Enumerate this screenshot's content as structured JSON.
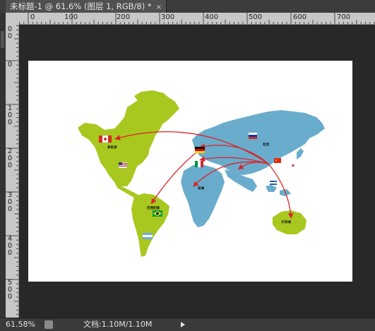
{
  "document_tab": {
    "title": "未标题-1 @ 61.6% (图层 1, RGB/8) *",
    "close": "×"
  },
  "ruler_top_labels": [
    "0",
    "100",
    "200",
    "300",
    "400",
    "500",
    "600",
    "700"
  ],
  "ruler_left_labels": [
    {
      "digits": [
        "0"
      ]
    },
    {
      "digits": [
        "1",
        "0",
        "0"
      ]
    },
    {
      "digits": [
        "2",
        "0",
        "0"
      ]
    },
    {
      "digits": [
        "3",
        "0",
        "0"
      ]
    },
    {
      "digits": [
        "4",
        "0",
        "0"
      ]
    },
    {
      "digits": [
        "5",
        "0",
        "0"
      ]
    }
  ],
  "ruler_left_offset": {
    "digits": [
      "0",
      "0"
    ]
  },
  "map": {
    "land_colors": {
      "americas_australia": "#a8c81f",
      "eurasia_africa": "#6aaccb",
      "route": "#d9252c"
    },
    "labels": {
      "canada": "多伦多",
      "brazil": "巴西利亚",
      "china": "北京",
      "africa": "非洲",
      "australia": "大洋洲"
    }
  },
  "status": {
    "zoom": "61.58%",
    "doc_info": "文档:1.10M/1.10M"
  }
}
